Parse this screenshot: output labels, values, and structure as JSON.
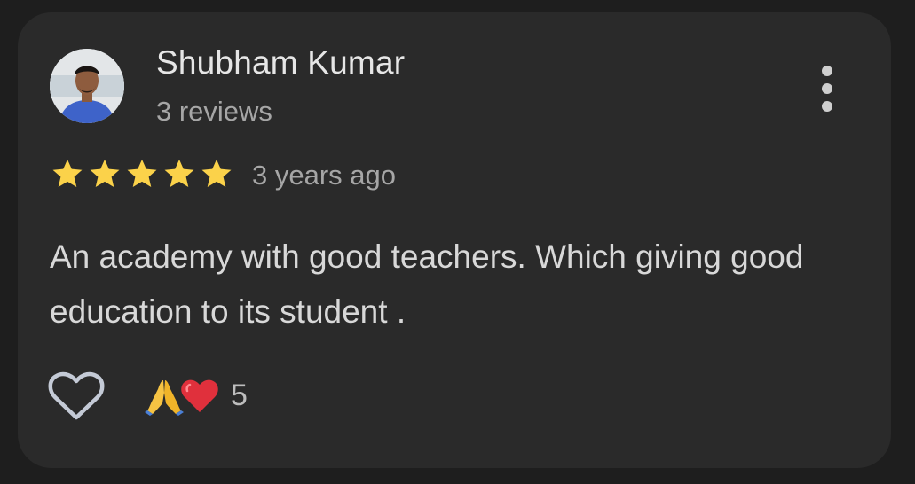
{
  "review": {
    "author": "Shubham Kumar",
    "review_count": "3 reviews",
    "rating": 5,
    "rating_max": 5,
    "time_ago": "3 years ago",
    "text": "An academy with good teachers. Which giving good education to its student .",
    "reaction_count": "5"
  },
  "icons": {
    "more": "more-vert-icon",
    "like": "heart-outline-icon",
    "reactions": [
      "folded-hands-emoji",
      "red-heart-emoji"
    ]
  },
  "colors": {
    "background": "#1e1e1e",
    "card": "#2a2a2a",
    "star": "#fbd24a",
    "heart_reaction": "#e0303c"
  }
}
